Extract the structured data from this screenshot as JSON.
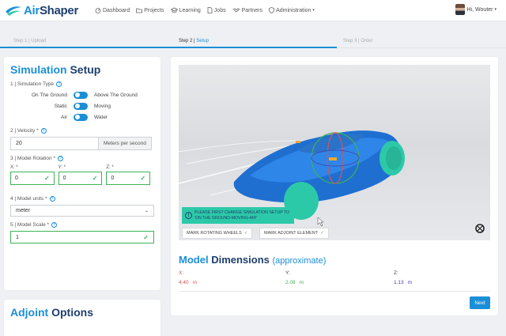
{
  "app": {
    "brand_air": "Air",
    "brand_shaper": "Shaper"
  },
  "nav": [
    {
      "label": "Dashboard",
      "icon": "dashboard-icon"
    },
    {
      "label": "Projects",
      "icon": "folder-icon"
    },
    {
      "label": "Learning",
      "icon": "graduation-cap-icon"
    },
    {
      "label": "Jobs",
      "icon": "file-icon"
    },
    {
      "label": "Partners",
      "icon": "handshake-icon"
    },
    {
      "label": "Administration",
      "icon": "shield-icon"
    }
  ],
  "user": {
    "greeting": "Hi, Wouter"
  },
  "steps": [
    {
      "prefix": "Step 1 |",
      "name": "Upload"
    },
    {
      "prefix": "Step 2 |",
      "name": "Setup"
    },
    {
      "prefix": "Step 3 |",
      "name": "Order"
    }
  ],
  "setup": {
    "title_accent": "Simulation",
    "title_rest": "Setup",
    "sim_type_label": "1 | Simulation Type",
    "toggles": [
      {
        "left": "On The Ground",
        "right": "Above The Ground"
      },
      {
        "left": "Static",
        "right": "Moving"
      },
      {
        "left": "Air",
        "right": "Water"
      }
    ],
    "velocity_label": "2 | Velocity *",
    "velocity_value": "20",
    "velocity_unit": "Meters per second",
    "rotation_label": "3 | Model Rotation *",
    "rotation": [
      {
        "axis": "X: *",
        "value": "0"
      },
      {
        "axis": "Y: *",
        "value": "0"
      },
      {
        "axis": "Z: *",
        "value": "0"
      }
    ],
    "units_label": "4 | Model units *",
    "units_value": "meter",
    "scale_label": "5 | Model Scale *",
    "scale_value": "1"
  },
  "adjoint": {
    "title_accent": "Adjoint",
    "title_rest": "Options"
  },
  "viewer": {
    "warning_line1": "PLEASE FIRST CHANGE SIMULATION SETUP TO",
    "warning_line2": "'ON THE GROUND-MOVING-AIR'",
    "chip_wheels": "MARK ROTATING WHEELS",
    "chip_adjoint": "MARK ADJOINT ELEMENT"
  },
  "dimensions": {
    "title_accent": "Model",
    "title_rest": "Dimensions",
    "approx": "(approximate)",
    "x": {
      "label": "X:",
      "value": "4.40",
      "unit": "m",
      "color": "#d9534f"
    },
    "y": {
      "label": "Y:",
      "value": "2.08",
      "unit": "m",
      "color": "#3fb356"
    },
    "z": {
      "label": "Z:",
      "value": "1.13",
      "unit": "m",
      "color": "#4a3fa8"
    }
  },
  "next_label": "Next",
  "colors": {
    "brand_blue": "#1a8fd8",
    "navy": "#1d3f6e",
    "teal": "#2cc9a8",
    "green": "#3fb356"
  }
}
